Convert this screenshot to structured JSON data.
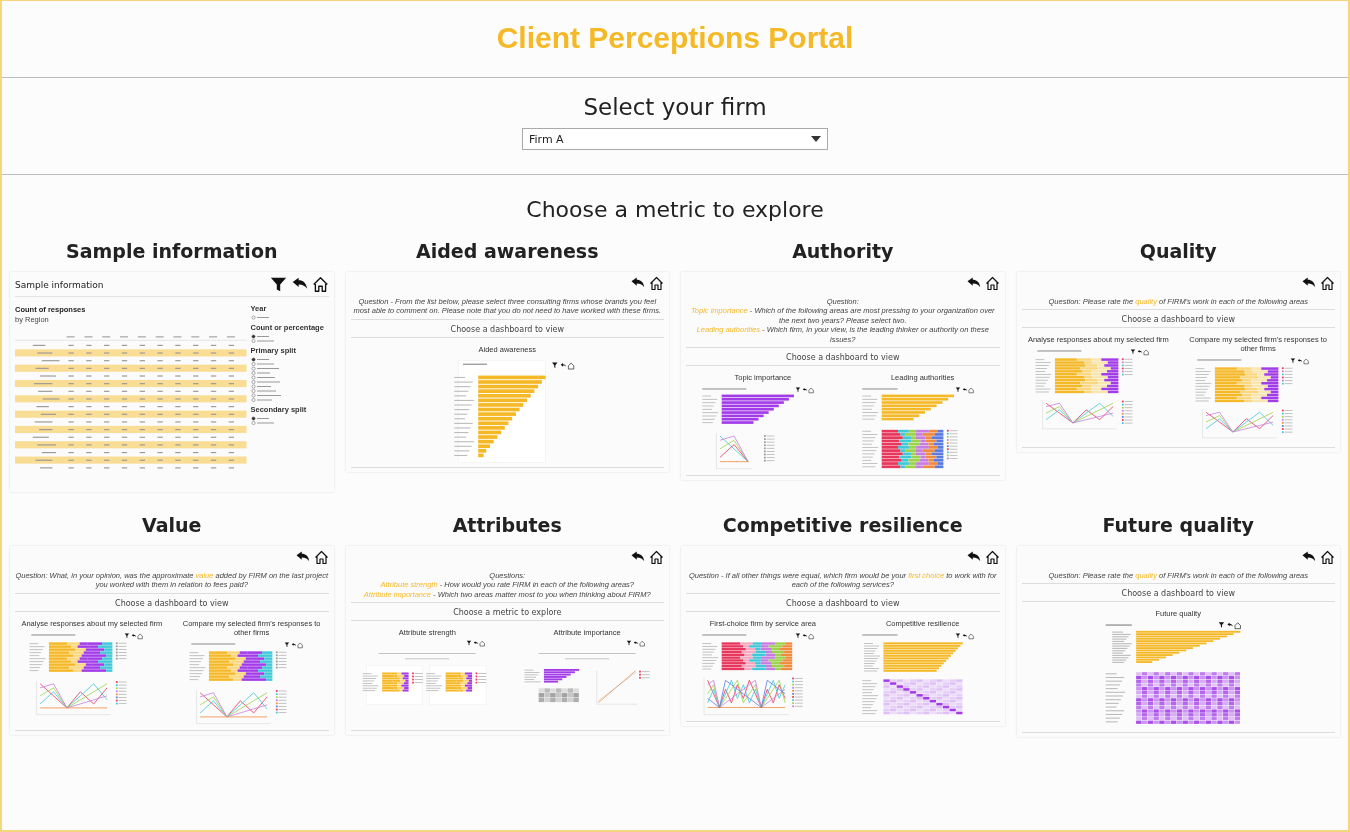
{
  "title": "Client Perceptions Portal",
  "firm_select": {
    "label": "Select your firm",
    "value": "Firm A"
  },
  "metrics_heading": "Choose a metric to explore",
  "metrics": [
    {
      "title": "Sample information",
      "preview": {
        "kind": "table",
        "has_filter": true,
        "heading": "Sample information",
        "table_title": "Count of responses",
        "table_subtitle": "by Region",
        "controls": [
          "Year",
          "Count or percentage",
          "Primary split",
          "Secondary split"
        ]
      }
    },
    {
      "title": "Aided awareness",
      "preview": {
        "kind": "dashboard",
        "has_filter": false,
        "question": [
          "Question - From the list below, please select three consulting firms whose brands you feel most able to comment on. Please note that you do not need to have worked with these firms."
        ],
        "chooser": "Choose a dashboard to view",
        "panels": [
          {
            "title": "Aided awareness",
            "kind": "awareness"
          }
        ]
      }
    },
    {
      "title": "Authority",
      "preview": {
        "kind": "dashboard",
        "has_filter": false,
        "question": [
          "Question:",
          "**Topic importance** - Which of the following areas are most pressing to your organization over the next two years? Please select two.",
          "**Leading authorities** - Which firm, in your view, is the leading thinker or authority on these issues?"
        ],
        "chooser": "Choose a dashboard to view",
        "panels": [
          {
            "title": "Topic importance",
            "kind": "topic"
          },
          {
            "title": "Leading authorities",
            "kind": "leading"
          }
        ]
      }
    },
    {
      "title": "Quality",
      "preview": {
        "kind": "dashboard",
        "has_filter": false,
        "question": [
          "Question: Please rate the **quality** of FIRM's work in each of the following areas"
        ],
        "chooser": "Choose a dashboard to view",
        "panels": [
          {
            "title": "Analyse responses about my selected firm",
            "kind": "rating"
          },
          {
            "title": "Compare my selected firm's responses to other firms",
            "kind": "rating"
          }
        ]
      }
    },
    {
      "title": "Value",
      "preview": {
        "kind": "dashboard",
        "has_filter": false,
        "question": [
          "Question: What, in your opinion, was the approximate **value** added by FIRM on the last project you worked with them in relation to fees paid?"
        ],
        "chooser": "Choose a dashboard to view",
        "panels": [
          {
            "title": "Analyse responses about my selected firm",
            "kind": "value"
          },
          {
            "title": "Compare my selected firm's responses to other firms",
            "kind": "value"
          }
        ]
      }
    },
    {
      "title": "Attributes",
      "preview": {
        "kind": "dashboard",
        "has_filter": false,
        "question": [
          "Questions:",
          "**Attribute strength** - How would you rate FIRM in each of the following areas?",
          "**Attribute importance** - Which two areas matter most to you when thinking about FIRM?"
        ],
        "chooser": "Choose a metric to explore",
        "panels": [
          {
            "title": "Attribute strength",
            "kind": "strength"
          },
          {
            "title": "Attribute importance",
            "kind": "importance"
          }
        ]
      }
    },
    {
      "title": "Competitive resilience",
      "preview": {
        "kind": "dashboard",
        "has_filter": false,
        "question": [
          "Question - If all other things were equal, which firm would be your **first choice** to work with for each of the following services?"
        ],
        "chooser": "Choose a dashboard to view",
        "panels": [
          {
            "title": "First-choice firm by service area",
            "kind": "firstchoice"
          },
          {
            "title": "Competitive resilience",
            "kind": "resilience"
          }
        ]
      }
    },
    {
      "title": "Future quality",
      "preview": {
        "kind": "dashboard",
        "has_filter": false,
        "question": [
          "Question: Please rate the **quality** of FIRM's work in each of the following areas"
        ],
        "chooser": "Choose a dashboard to view",
        "panels": [
          {
            "title": "Future quality",
            "kind": "future"
          }
        ]
      }
    }
  ]
}
